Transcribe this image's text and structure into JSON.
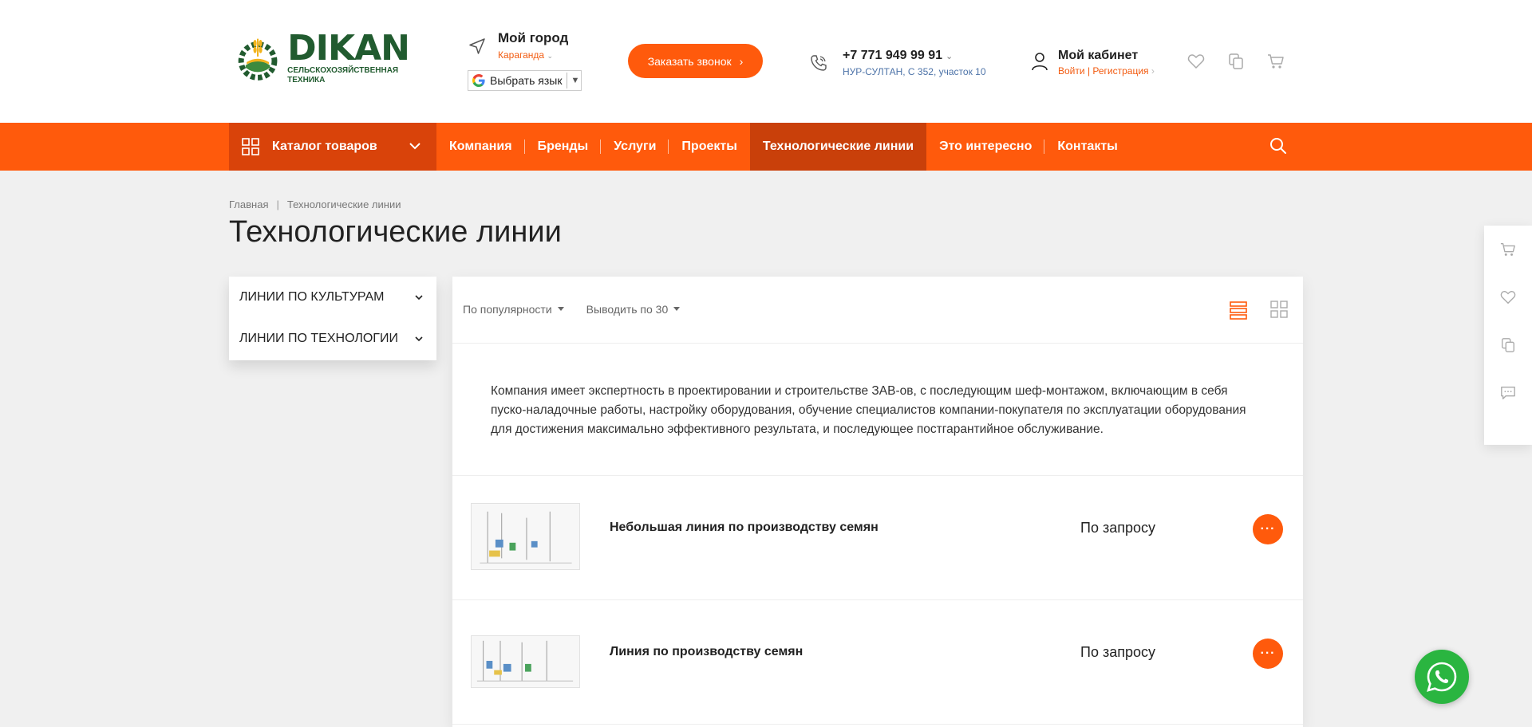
{
  "header": {
    "logo": {
      "title": "DIKAN",
      "subtitle_line1": "СЕЛЬСКОХОЗЯЙСТВЕННАЯ",
      "subtitle_line2": "ТЕХНИКА"
    },
    "city": {
      "label": "Мой город",
      "value": "Караганда",
      "icon": "location-arrow-icon"
    },
    "language": {
      "label": "Выбрать язык",
      "icon": "google-icon"
    },
    "callback_button": "Заказать звонок",
    "phone": {
      "number": "+7 771 949 99 91",
      "address": "НУР-СУЛТАН, С 352, участок 10",
      "icon": "phone-icon"
    },
    "cabinet": {
      "title": "Мой кабинет",
      "login": "Войти",
      "register": "Регистрация",
      "separator": "|"
    },
    "icons": [
      "heart-icon",
      "compare-icon",
      "cart-icon"
    ]
  },
  "nav": {
    "catalog_label": "Каталог товаров",
    "items": [
      {
        "label": "Компания"
      },
      {
        "label": "Бренды"
      },
      {
        "label": "Услуги"
      },
      {
        "label": "Проекты"
      },
      {
        "label": "Технологические линии",
        "active": true
      },
      {
        "label": "Это интересно"
      },
      {
        "label": "Контакты"
      }
    ]
  },
  "breadcrumb": {
    "home": "Главная",
    "separator": "|",
    "current": "Технологические линии"
  },
  "page_title": "Технологические линии",
  "filters": [
    {
      "label": "ЛИНИИ ПО КУЛЬТУРАМ"
    },
    {
      "label": "ЛИНИИ ПО ТЕХНОЛОГИИ"
    }
  ],
  "toolbar": {
    "sort": "По популярности",
    "per_page": "Выводить по 30"
  },
  "description": "Компания имеет экспертность в проектировании и строительстве ЗАВ-ов, с последующим шеф-монтажом, включающим в себя пуско-наладочные работы, настройку оборудования, обучение специалистов компании-покупателя по эксплуатации оборудования для достижения максимально эффективного результата, и последующее постгарантийное обслуживание.",
  "products": [
    {
      "name": "Небольшая линия по производству семян",
      "price": "По запросу",
      "more": "···"
    },
    {
      "name": "Линия по производству семян",
      "price": "По запросу",
      "more": "···"
    }
  ],
  "side_panel": [
    "cart-icon",
    "heart-icon",
    "compare-icon",
    "chat-icon"
  ],
  "colors": {
    "accent": "#ff5a0c",
    "accent_dark": "#d9430a",
    "brand_green": "#215b2f",
    "whatsapp": "#2ab540"
  }
}
